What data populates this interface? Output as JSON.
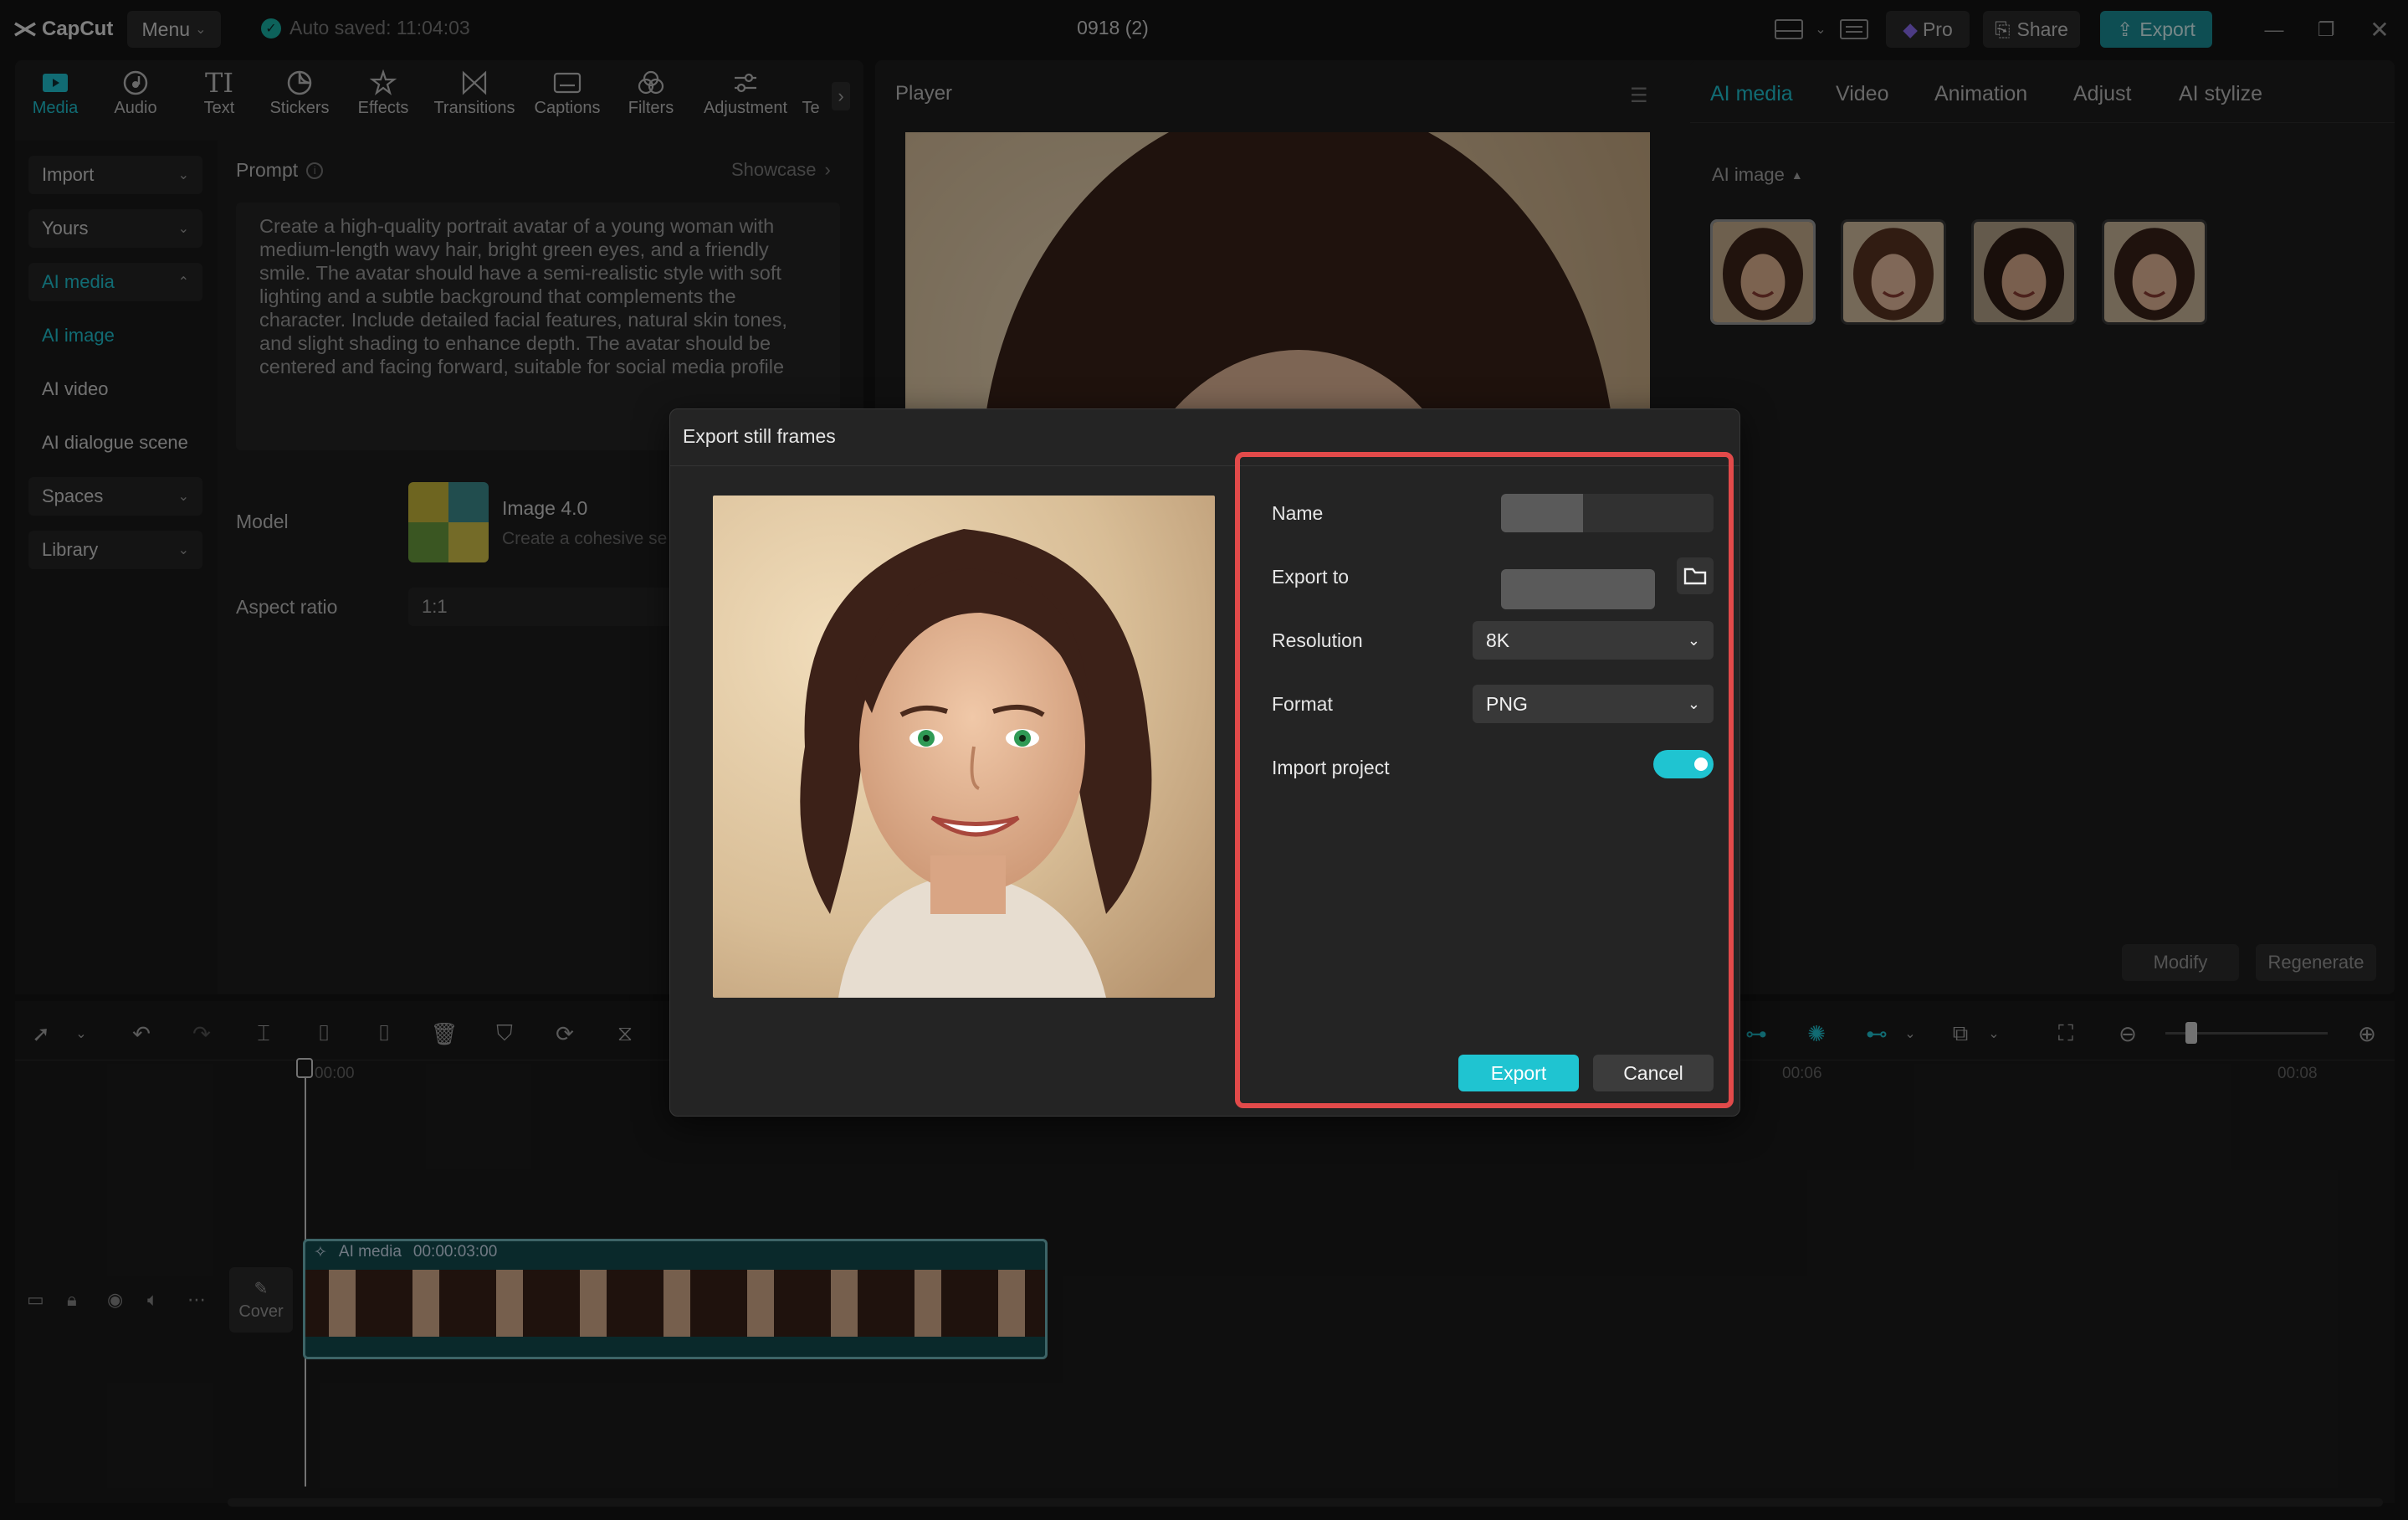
{
  "app": {
    "brand": "CapCut",
    "menu_label": "Menu",
    "autosave": "Auto saved: 11:04:03",
    "project_title": "0918 (2)",
    "pro_label": "Pro",
    "share_label": "Share",
    "export_label": "Export"
  },
  "toolbar": {
    "items": [
      {
        "label": "Media",
        "icon": "media-icon"
      },
      {
        "label": "Audio",
        "icon": "audio-icon"
      },
      {
        "label": "Text",
        "icon": "text-icon"
      },
      {
        "label": "Stickers",
        "icon": "stickers-icon"
      },
      {
        "label": "Effects",
        "icon": "effects-icon"
      },
      {
        "label": "Transitions",
        "icon": "transitions-icon"
      },
      {
        "label": "Captions",
        "icon": "captions-icon"
      },
      {
        "label": "Filters",
        "icon": "filters-icon"
      },
      {
        "label": "Adjustment",
        "icon": "adjustment-icon"
      },
      {
        "label": "Te",
        "icon": "template-icon"
      }
    ]
  },
  "sidebar": {
    "import": "Import",
    "yours": "Yours",
    "ai_media": "AI media",
    "ai_image": "AI image",
    "ai_video": "AI video",
    "ai_dialogue": "AI dialogue scene",
    "spaces": "Spaces",
    "library": "Library"
  },
  "prompt": {
    "label": "Prompt",
    "showcase": "Showcase",
    "text": "Create a high-quality portrait avatar of a young woman with medium-length wavy hair, bright green eyes, and a friendly smile. The avatar should have a semi-realistic style with soft lighting and a subtle background that complements the character. Include detailed facial features, natural skin tones, and slight shading to enhance depth. The avatar should be centered and facing forward, suitable for social media profile",
    "model_label": "Model",
    "model_name": "Image 4.0",
    "model_desc": "Create a cohesive se",
    "aspect_label": "Aspect ratio",
    "aspect_value": "1:1"
  },
  "player": {
    "title": "Player"
  },
  "right_panel": {
    "tabs": [
      "AI media",
      "Video",
      "Animation",
      "Adjust",
      "AI stylize"
    ],
    "section": "AI image",
    "modify": "Modify",
    "regenerate": "Regenerate"
  },
  "timeline": {
    "clip_label": "AI media",
    "clip_duration": "00:00:03:00",
    "cover_label": "Cover",
    "time_0": "00:00",
    "time_6": "00:06",
    "time_8": "00:08"
  },
  "modal": {
    "title": "Export still frames",
    "name_label": "Name",
    "export_to_label": "Export to",
    "resolution_label": "Resolution",
    "resolution_value": "8K",
    "format_label": "Format",
    "format_value": "PNG",
    "import_project_label": "Import project",
    "import_project_on": true,
    "export_button": "Export",
    "cancel_button": "Cancel"
  },
  "colors": {
    "accent": "#1fc4d1",
    "highlight": "#e24a4a",
    "bg": "#141414",
    "panel": "#1e1e1e"
  }
}
